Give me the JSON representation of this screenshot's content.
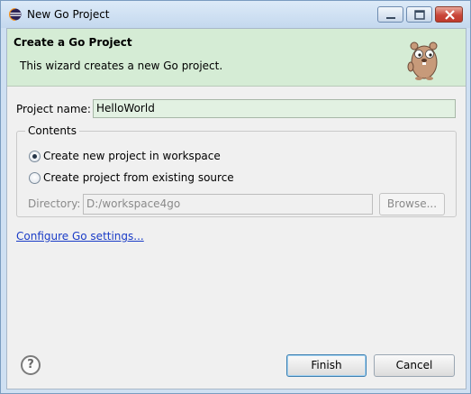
{
  "window": {
    "title": "New Go Project",
    "icon": "eclipse-icon"
  },
  "header": {
    "title": "Create a Go Project",
    "description": "This wizard creates a new Go project.",
    "image": "gopher-icon"
  },
  "form": {
    "project_name_label": "Project name:",
    "project_name_value": "HelloWorld",
    "contents_label": "Contents",
    "radio_new_label": "Create new project in workspace",
    "radio_existing_label": "Create project from existing source",
    "radio_selected": "new",
    "directory_label": "Directory:",
    "directory_value": "D:/workspace4go",
    "browse_label": "Browse...",
    "configure_link": "Configure Go settings..."
  },
  "footer": {
    "help_icon": "help-icon",
    "finish_label": "Finish",
    "cancel_label": "Cancel"
  }
}
